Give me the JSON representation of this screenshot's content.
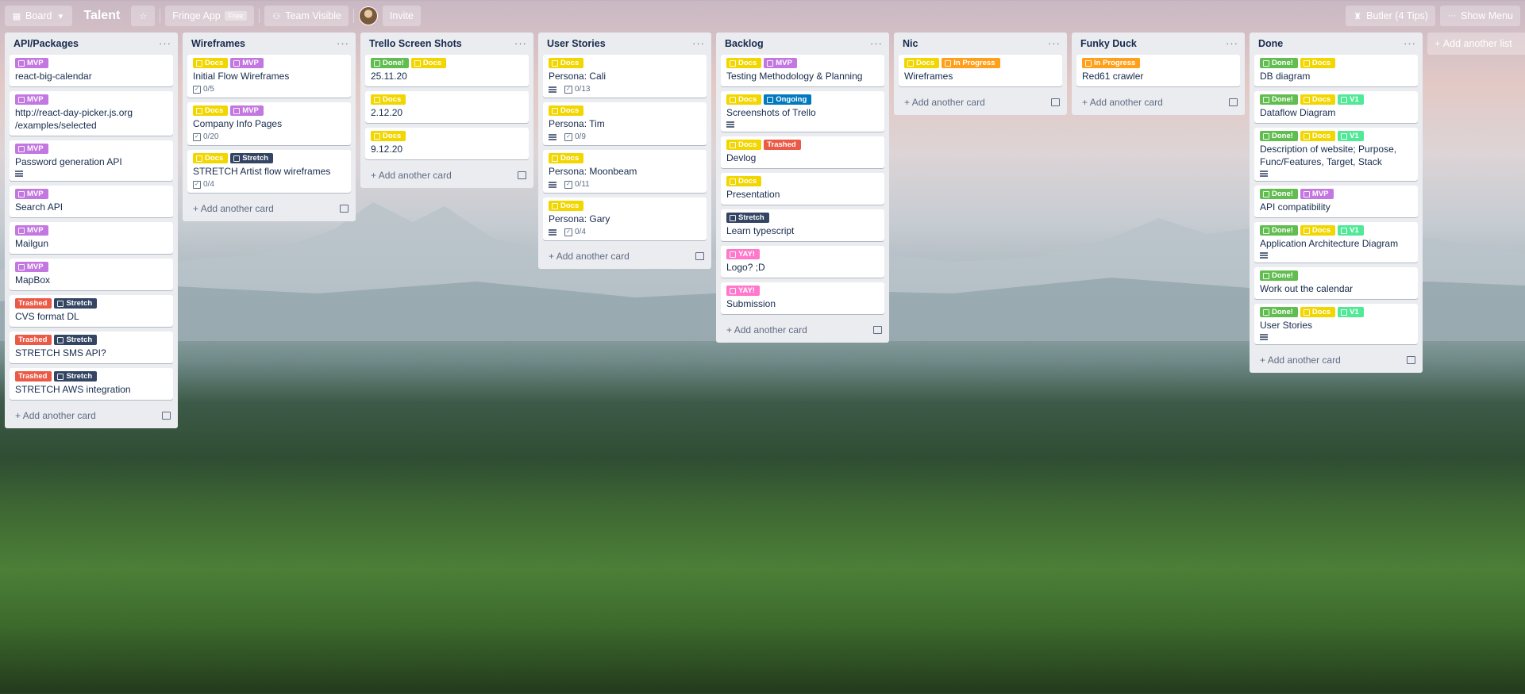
{
  "topbar": {
    "board_button": "Board",
    "board_title": "Talent",
    "workspace": "Fringe App",
    "workspace_badge": "Free",
    "visibility": "Team Visible",
    "invite": "Invite",
    "butler": "Butler (4 Tips)",
    "show_menu": "Show Menu"
  },
  "add_card_label": "Add another card",
  "add_list_label": "Add another list",
  "colors": {
    "MVP": "#c377e0",
    "Trashed": "#eb5a46",
    "Stretch": "#344563",
    "Docs": "#f2d600",
    "Done!": "#61bd4f",
    "Ongoing": "#0079bf",
    "In Progress": "#ff9f1a",
    "YAY!": "#ff78cb",
    "V1": "#51e898"
  },
  "lists": [
    {
      "title": "API/Packages",
      "cards": [
        {
          "labels": [
            "MVP"
          ],
          "title": "react-big-calendar"
        },
        {
          "labels": [
            "MVP"
          ],
          "title": "http://react-day-picker.js.org /examples/selected"
        },
        {
          "labels": [
            "MVP"
          ],
          "title": "Password generation API",
          "desc": true
        },
        {
          "labels": [
            "MVP"
          ],
          "title": "Search API"
        },
        {
          "labels": [
            "MVP"
          ],
          "title": "Mailgun"
        },
        {
          "labels": [
            "MVP"
          ],
          "title": "MapBox"
        },
        {
          "labels": [
            "Trashed",
            "Stretch"
          ],
          "title": "CVS format DL"
        },
        {
          "labels": [
            "Trashed",
            "Stretch"
          ],
          "title": "STRETCH SMS API?"
        },
        {
          "labels": [
            "Trashed",
            "Stretch"
          ],
          "title": "STRETCH AWS integration"
        }
      ]
    },
    {
      "title": "Wireframes",
      "cards": [
        {
          "labels": [
            "Docs",
            "MVP"
          ],
          "title": "Initial Flow Wireframes",
          "check": "0/5"
        },
        {
          "labels": [
            "Docs",
            "MVP"
          ],
          "title": "Company Info Pages",
          "check": "0/20"
        },
        {
          "labels": [
            "Docs",
            "Stretch"
          ],
          "title": "STRETCH Artist flow wireframes",
          "check": "0/4"
        }
      ]
    },
    {
      "title": "Trello Screen Shots",
      "cards": [
        {
          "labels": [
            "Done!",
            "Docs"
          ],
          "title": "25.11.20"
        },
        {
          "labels": [
            "Docs"
          ],
          "title": "2.12.20"
        },
        {
          "labels": [
            "Docs"
          ],
          "title": "9.12.20"
        }
      ]
    },
    {
      "title": "User Stories",
      "cards": [
        {
          "labels": [
            "Docs"
          ],
          "title": "Persona: Cali",
          "desc": true,
          "check": "0/13"
        },
        {
          "labels": [
            "Docs"
          ],
          "title": "Persona: Tim",
          "desc": true,
          "check": "0/9"
        },
        {
          "labels": [
            "Docs"
          ],
          "title": "Persona: Moonbeam",
          "desc": true,
          "check": "0/11"
        },
        {
          "labels": [
            "Docs"
          ],
          "title": "Persona: Gary",
          "desc": true,
          "check": "0/4"
        }
      ]
    },
    {
      "title": "Backlog",
      "cards": [
        {
          "labels": [
            "Docs",
            "MVP"
          ],
          "title": "Testing Methodology & Planning"
        },
        {
          "labels": [
            "Docs",
            "Ongoing"
          ],
          "title": "Screenshots of Trello",
          "desc": true
        },
        {
          "labels": [
            "Docs",
            "Trashed"
          ],
          "title": "Devlog"
        },
        {
          "labels": [
            "Docs"
          ],
          "title": "Presentation"
        },
        {
          "labels": [
            "Stretch"
          ],
          "title": "Learn typescript"
        },
        {
          "labels": [
            "YAY!"
          ],
          "title": "Logo? ;D"
        },
        {
          "labels": [
            "YAY!"
          ],
          "title": "Submission"
        }
      ]
    },
    {
      "title": "Nic",
      "cards": [
        {
          "labels": [
            "Docs",
            "In Progress"
          ],
          "title": "Wireframes"
        }
      ]
    },
    {
      "title": "Funky Duck",
      "cards": [
        {
          "labels": [
            "In Progress"
          ],
          "title": "Red61 crawler"
        }
      ]
    },
    {
      "title": "Done",
      "cards": [
        {
          "labels": [
            "Done!",
            "Docs"
          ],
          "title": "DB diagram"
        },
        {
          "labels": [
            "Done!",
            "Docs",
            "V1"
          ],
          "title": "Dataflow Diagram"
        },
        {
          "labels": [
            "Done!",
            "Docs",
            "V1"
          ],
          "title": "Description of website; Purpose, Func/Features, Target, Stack",
          "desc": true
        },
        {
          "labels": [
            "Done!",
            "MVP"
          ],
          "title": "API compatibility"
        },
        {
          "labels": [
            "Done!",
            "Docs",
            "V1"
          ],
          "title": "Application Architecture Diagram",
          "desc": true
        },
        {
          "labels": [
            "Done!"
          ],
          "title": "Work out the calendar"
        },
        {
          "labels": [
            "Done!",
            "Docs",
            "V1"
          ],
          "title": "User Stories",
          "desc": true
        }
      ]
    }
  ]
}
